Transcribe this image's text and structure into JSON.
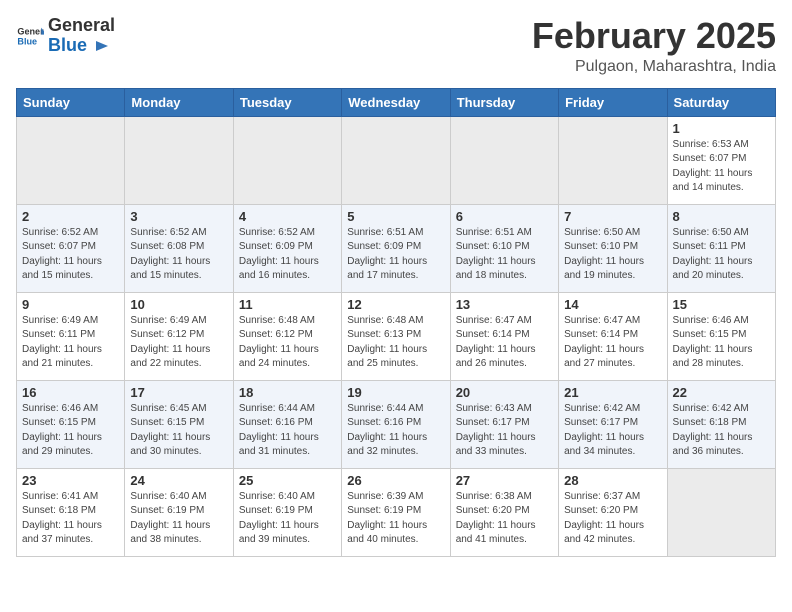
{
  "header": {
    "logo_general": "General",
    "logo_blue": "Blue",
    "month_title": "February 2025",
    "location": "Pulgaon, Maharashtra, India"
  },
  "weekdays": [
    "Sunday",
    "Monday",
    "Tuesday",
    "Wednesday",
    "Thursday",
    "Friday",
    "Saturday"
  ],
  "weeks": [
    [
      {
        "day": "",
        "empty": true
      },
      {
        "day": "",
        "empty": true
      },
      {
        "day": "",
        "empty": true
      },
      {
        "day": "",
        "empty": true
      },
      {
        "day": "",
        "empty": true
      },
      {
        "day": "",
        "empty": true
      },
      {
        "day": "1",
        "sunrise": "6:53 AM",
        "sunset": "6:07 PM",
        "daylight": "11 hours and 14 minutes."
      }
    ],
    [
      {
        "day": "2",
        "sunrise": "6:52 AM",
        "sunset": "6:07 PM",
        "daylight": "11 hours and 15 minutes."
      },
      {
        "day": "3",
        "sunrise": "6:52 AM",
        "sunset": "6:08 PM",
        "daylight": "11 hours and 15 minutes."
      },
      {
        "day": "4",
        "sunrise": "6:52 AM",
        "sunset": "6:09 PM",
        "daylight": "11 hours and 16 minutes."
      },
      {
        "day": "5",
        "sunrise": "6:51 AM",
        "sunset": "6:09 PM",
        "daylight": "11 hours and 17 minutes."
      },
      {
        "day": "6",
        "sunrise": "6:51 AM",
        "sunset": "6:10 PM",
        "daylight": "11 hours and 18 minutes."
      },
      {
        "day": "7",
        "sunrise": "6:50 AM",
        "sunset": "6:10 PM",
        "daylight": "11 hours and 19 minutes."
      },
      {
        "day": "8",
        "sunrise": "6:50 AM",
        "sunset": "6:11 PM",
        "daylight": "11 hours and 20 minutes."
      }
    ],
    [
      {
        "day": "9",
        "sunrise": "6:49 AM",
        "sunset": "6:11 PM",
        "daylight": "11 hours and 21 minutes."
      },
      {
        "day": "10",
        "sunrise": "6:49 AM",
        "sunset": "6:12 PM",
        "daylight": "11 hours and 22 minutes."
      },
      {
        "day": "11",
        "sunrise": "6:48 AM",
        "sunset": "6:12 PM",
        "daylight": "11 hours and 24 minutes."
      },
      {
        "day": "12",
        "sunrise": "6:48 AM",
        "sunset": "6:13 PM",
        "daylight": "11 hours and 25 minutes."
      },
      {
        "day": "13",
        "sunrise": "6:47 AM",
        "sunset": "6:14 PM",
        "daylight": "11 hours and 26 minutes."
      },
      {
        "day": "14",
        "sunrise": "6:47 AM",
        "sunset": "6:14 PM",
        "daylight": "11 hours and 27 minutes."
      },
      {
        "day": "15",
        "sunrise": "6:46 AM",
        "sunset": "6:15 PM",
        "daylight": "11 hours and 28 minutes."
      }
    ],
    [
      {
        "day": "16",
        "sunrise": "6:46 AM",
        "sunset": "6:15 PM",
        "daylight": "11 hours and 29 minutes."
      },
      {
        "day": "17",
        "sunrise": "6:45 AM",
        "sunset": "6:15 PM",
        "daylight": "11 hours and 30 minutes."
      },
      {
        "day": "18",
        "sunrise": "6:44 AM",
        "sunset": "6:16 PM",
        "daylight": "11 hours and 31 minutes."
      },
      {
        "day": "19",
        "sunrise": "6:44 AM",
        "sunset": "6:16 PM",
        "daylight": "11 hours and 32 minutes."
      },
      {
        "day": "20",
        "sunrise": "6:43 AM",
        "sunset": "6:17 PM",
        "daylight": "11 hours and 33 minutes."
      },
      {
        "day": "21",
        "sunrise": "6:42 AM",
        "sunset": "6:17 PM",
        "daylight": "11 hours and 34 minutes."
      },
      {
        "day": "22",
        "sunrise": "6:42 AM",
        "sunset": "6:18 PM",
        "daylight": "11 hours and 36 minutes."
      }
    ],
    [
      {
        "day": "23",
        "sunrise": "6:41 AM",
        "sunset": "6:18 PM",
        "daylight": "11 hours and 37 minutes."
      },
      {
        "day": "24",
        "sunrise": "6:40 AM",
        "sunset": "6:19 PM",
        "daylight": "11 hours and 38 minutes."
      },
      {
        "day": "25",
        "sunrise": "6:40 AM",
        "sunset": "6:19 PM",
        "daylight": "11 hours and 39 minutes."
      },
      {
        "day": "26",
        "sunrise": "6:39 AM",
        "sunset": "6:19 PM",
        "daylight": "11 hours and 40 minutes."
      },
      {
        "day": "27",
        "sunrise": "6:38 AM",
        "sunset": "6:20 PM",
        "daylight": "11 hours and 41 minutes."
      },
      {
        "day": "28",
        "sunrise": "6:37 AM",
        "sunset": "6:20 PM",
        "daylight": "11 hours and 42 minutes."
      },
      {
        "day": "",
        "empty": true
      }
    ]
  ]
}
